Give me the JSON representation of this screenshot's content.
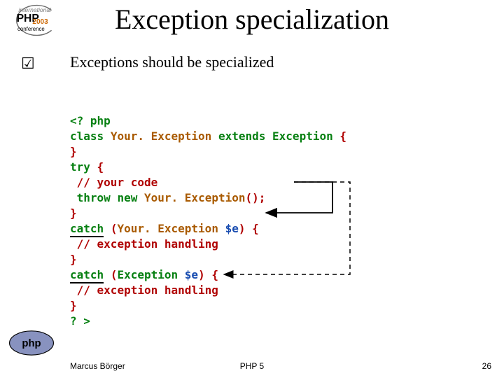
{
  "title": "Exception specialization",
  "bullet_glyph": "☑",
  "subheading": "Exceptions should be specialized",
  "code": {
    "l1": "<? php",
    "kw_class": "class",
    "cls_your": "Your. Exception",
    "kw_extends": "extends",
    "cls_base": "Exception",
    "kw_try": "try",
    "cm_yourcode": "// your code",
    "kw_throw": "throw",
    "kw_new": "new",
    "ctor": "Your. Exception",
    "parens": "();",
    "kw_catch": "catch",
    "catch1_open": "(",
    "catch1_type": "Your. Exception",
    "catch1_var": "$e",
    "catch1_close": ") {",
    "cm_handle": "// exception handling",
    "catch2_type": "Exception",
    "catch2_var": "$e",
    "catch2_close": ") {",
    "l_end": "? >"
  },
  "footer": {
    "author": "Marcus Börger",
    "center": "PHP 5",
    "page": "26"
  },
  "logos": {
    "conference": "international PHP 2003 conference",
    "php": "php"
  }
}
